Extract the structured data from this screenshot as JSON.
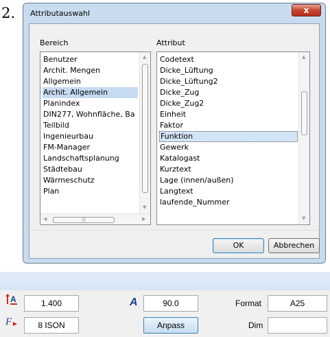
{
  "step_number": "2.",
  "dialog": {
    "title": "Attributauswahl",
    "close_label": "x",
    "bereich": {
      "label": "Bereich",
      "items": [
        "Benutzer",
        "Archit. Mengen",
        "Allgemein",
        "Archit. Allgemein",
        "Planindex",
        "DIN277, Wohnfläche, Ba",
        "Teilbild",
        "Ingenieurbau",
        "FM-Manager",
        "Landschaftsplanung",
        "Städtebau",
        "Wärmeschutz",
        "Plan"
      ],
      "selected_item": "Archit. Allgemein"
    },
    "attribut": {
      "label": "Attribut",
      "items": [
        "Codetext",
        "Dicke_Lüftung",
        "Dicke_Lüftung2",
        "Dicke_Zug",
        "Dicke_Zug2",
        "Einheit",
        "Faktor",
        "Funktion",
        "Gewerk",
        "Katalogast",
        "Kurztext",
        "Lage (innen/außen)",
        "Langtext",
        "laufende_Nummer"
      ],
      "selected_item": "Funktion"
    },
    "ok_label": "OK",
    "cancel_label": "Abbrechen"
  },
  "panel": {
    "height_value": "1.400",
    "angle_value": "90.0",
    "format_label": "Format",
    "format_value": "A25",
    "font_value": "8 ISON",
    "anpass_label": "Anpass",
    "dim_label": "Dim",
    "dim_value": ""
  },
  "colors": {
    "selection": "#c6dbf1",
    "dialog_frame": "#c9dcef",
    "close_button": "#c7442e"
  }
}
